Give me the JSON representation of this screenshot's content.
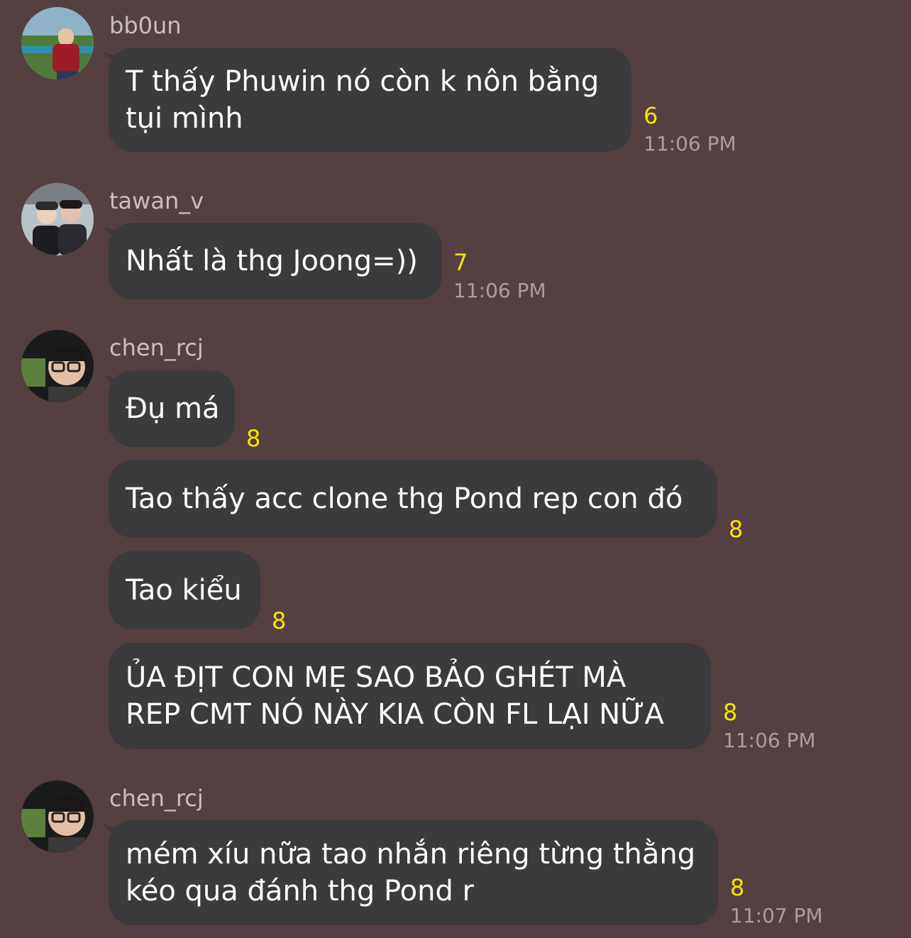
{
  "messages_groups": [
    {
      "username": "bb0un",
      "avatar": "bb0un-avatar",
      "messages": [
        {
          "text": "T thấy Phuwin nó còn k nôn bằng\ntụi mình",
          "count": "6",
          "time": "11:06 PM"
        }
      ]
    },
    {
      "username": "tawan_v",
      "avatar": "tawan_v-avatar",
      "messages": [
        {
          "text": "Nhất là thg Joong=))",
          "count": "7",
          "time": "11:06 PM"
        }
      ]
    },
    {
      "username": "chen_rcj",
      "avatar": "chen_rcj-avatar",
      "messages": [
        {
          "text": "Đụ má",
          "count": "8"
        },
        {
          "text": "Tao thấy acc clone thg Pond rep con đó",
          "count": "8"
        },
        {
          "text": "Tao kiểu",
          "count": "8"
        },
        {
          "text": "ỦA ĐỊT CON MẸ SAO BẢO GHÉT MÀ\nREP CMT NÓ NÀY KIA CÒN FL LẠI NỮA",
          "count": "8",
          "time": "11:06 PM"
        }
      ]
    },
    {
      "username": "chen_rcj",
      "avatar": "chen_rcj-avatar",
      "messages": [
        {
          "text": "mém xíu nữa tao nhắn riêng từng thằng\nkéo qua đánh thg Pond r",
          "count": "8",
          "time": "11:07 PM"
        }
      ]
    }
  ],
  "colors": {
    "background": "#554041",
    "bubble": "#3b3a3c",
    "count": "#f8e400",
    "time": "#a99d9d",
    "username": "#c9bfbf"
  }
}
